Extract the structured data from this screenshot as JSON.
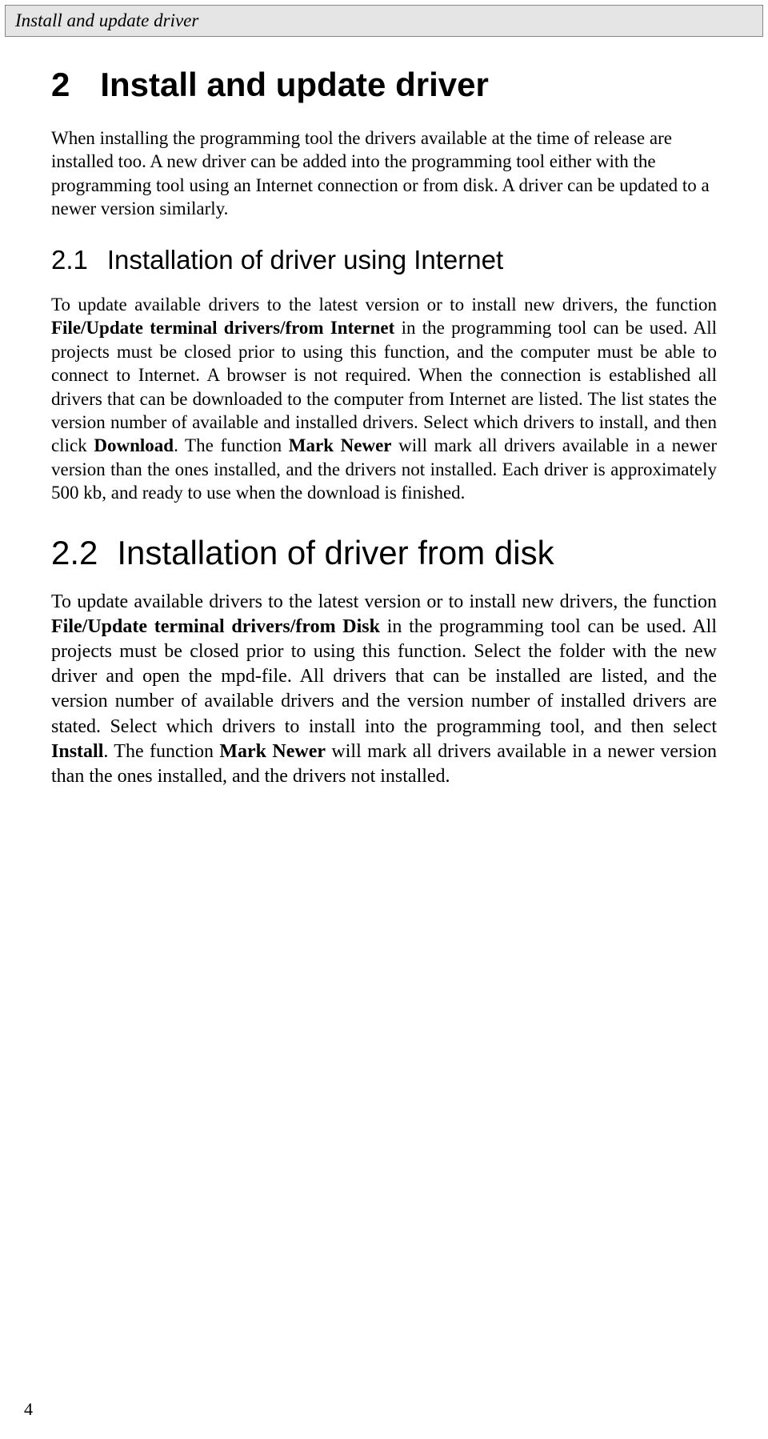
{
  "header": {
    "title": "Install and update driver"
  },
  "main": {
    "chapter_number": "2",
    "chapter_title": "Install and update driver",
    "intro": "When installing the programming tool the drivers available at the time of release are installed too. A new driver can be added into the programming tool either with the programming tool using an Internet connection or from disk. A driver can be updated to a newer version similarly.",
    "section1": {
      "number": "2.1",
      "title": "Installation of driver using Internet",
      "p_a": "To update available drivers to the latest version or to install new drivers, the function ",
      "p_b": "File/Update terminal drivers/from Internet",
      "p_c": " in the programming tool can be used. All projects must be closed prior to using this function, and the computer must be able to connect to Internet. A browser is not required. When the connection is established all drivers that can be downloaded to the computer from Internet are listed. The list states the version number of available and installed drivers. Select which drivers to install, and then click ",
      "p_d": "Download",
      "p_e": ". The function ",
      "p_f": "Mark Newer",
      "p_g": " will mark all drivers available in a newer version than the ones installed, and the drivers not installed. Each driver is approximately 500 kb, and ready to use when the download is finished."
    },
    "section2": {
      "number": "2.2",
      "title": "Installation of driver from disk",
      "p_a": "To update available drivers to the latest version or to install new drivers, the function ",
      "p_b": "File/Update terminal drivers/from Disk",
      "p_c": " in the programming tool can be used. All projects must be closed prior to using this function. Select the folder with the new driver and open the mpd-file. All drivers that can be installed are listed, and the version number of available drivers and the version number of installed drivers are stated. Select which drivers to install into the programming tool, and then select ",
      "p_d": "Install",
      "p_e": ". The function ",
      "p_f": "Mark Newer",
      "p_g": " will mark all drivers available in a newer version than the ones installed, and the drivers not installed."
    }
  },
  "page_number": "4"
}
